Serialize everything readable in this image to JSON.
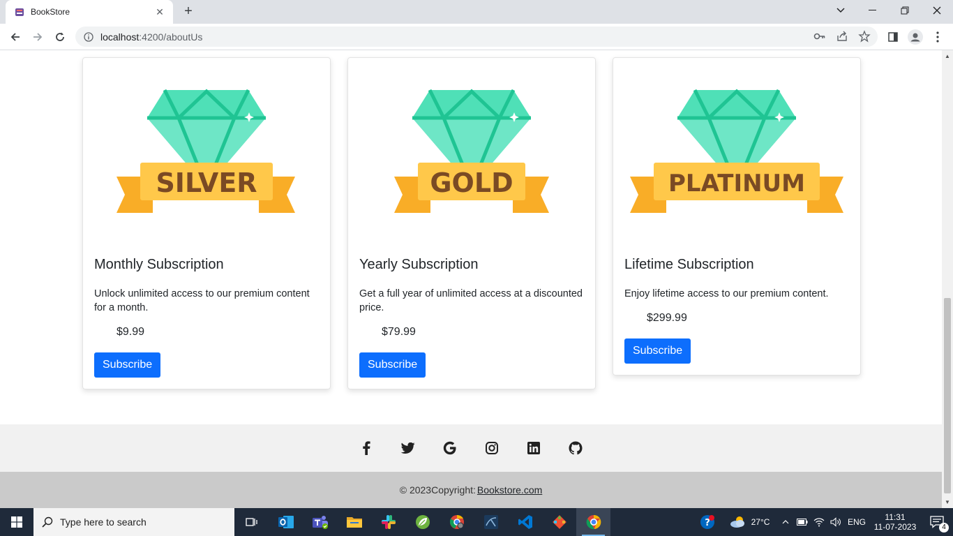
{
  "browser": {
    "tab_title": "BookStore",
    "url_host": "localhost",
    "url_path": ":4200/aboutUs"
  },
  "plans": [
    {
      "badge": "SILVER",
      "title": "Monthly Subscription",
      "description": "Unlock unlimited access to our premium content for a month.",
      "price": "$9.99",
      "button": "Subscribe"
    },
    {
      "badge": "GOLD",
      "title": "Yearly Subscription",
      "description": "Get a full year of unlimited access at a discounted price.",
      "price": "$79.99",
      "button": "Subscribe"
    },
    {
      "badge": "PLATINUM",
      "title": "Lifetime Subscription",
      "description": "Enjoy lifetime access to our premium content.",
      "price": "$299.99",
      "button": "Subscribe"
    }
  ],
  "social_icons": [
    "facebook-icon",
    "twitter-icon",
    "google-icon",
    "instagram-icon",
    "linkedin-icon",
    "github-icon"
  ],
  "footer": {
    "copyright": "© 2023Copyright:",
    "link": "Bookstore.com"
  },
  "taskbar": {
    "search_placeholder": "Type here to search",
    "temperature": "27°C",
    "language": "ENG",
    "time": "11:31",
    "date": "11-07-2023",
    "notifications": "4"
  },
  "colors": {
    "primary": "#0d6efd",
    "diamond": "#4fe0b7",
    "ribbon": "#ffc84a",
    "ribbon_dark": "#f9ad27",
    "badge_text": "#7a4a24"
  }
}
